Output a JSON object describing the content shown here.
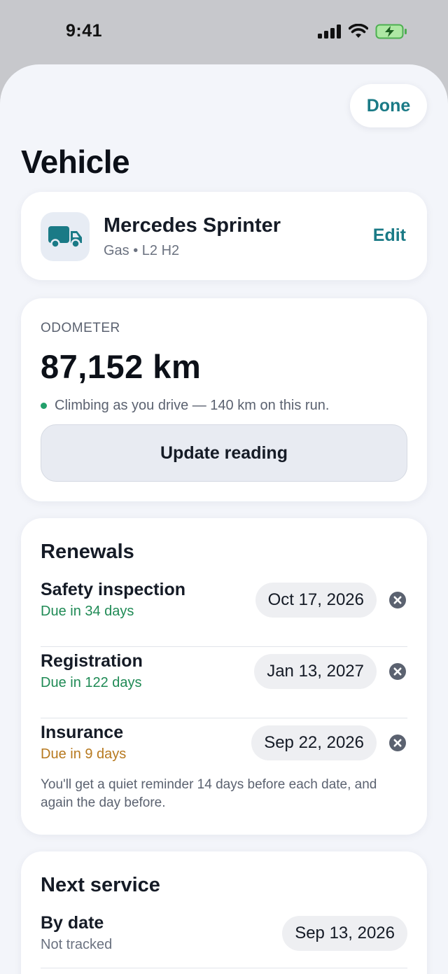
{
  "status_bar": {
    "time": "9:41"
  },
  "header": {
    "done_label": "Done",
    "title": "Vehicle"
  },
  "vehicle": {
    "name": "Mercedes Sprinter",
    "subtitle": "Gas • L2 H2",
    "edit_label": "Edit",
    "icon": "truck-icon"
  },
  "odometer": {
    "label": "ODOMETER",
    "value": "87,152 km",
    "status": "Climbing as you drive — 140 km on this run.",
    "update_label": "Update reading"
  },
  "renewals": {
    "heading": "Renewals",
    "items": [
      {
        "title": "Safety inspection",
        "due": "Due in 34 days",
        "date": "Oct 17, 2026"
      },
      {
        "title": "Registration",
        "due": "Due in 122 days",
        "date": "Jan 13, 2027"
      },
      {
        "title": "Insurance",
        "due": "Due in 9 days",
        "date": "Sep 22, 2026"
      }
    ],
    "note": "You'll get a quiet reminder 14 days before each date, and again the day before."
  },
  "next_service": {
    "heading": "Next service",
    "by_date": {
      "title": "By date",
      "sub": "Not tracked",
      "date": "Sep 13, 2026"
    }
  },
  "colors": {
    "accent": "#1a7a86",
    "due_ok": "#1f8a55",
    "due_soon": "#b7791f",
    "status_dot": "#22a06b"
  }
}
